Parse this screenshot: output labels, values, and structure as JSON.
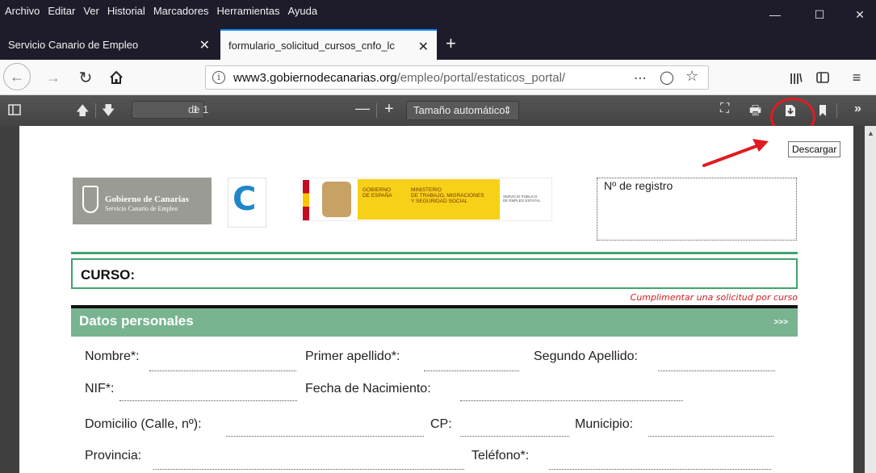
{
  "menu": [
    "Archivo",
    "Editar",
    "Ver",
    "Historial",
    "Marcadores",
    "Herramientas",
    "Ayuda"
  ],
  "tabs": [
    {
      "label": "Servicio Canario de Empleo",
      "active": false
    },
    {
      "label": "formulario_solicitud_cursos_cnfo_lc",
      "active": true
    }
  ],
  "address": {
    "host": "www3.gobiernodecanarias.org",
    "path": "/empleo/portal/estaticos_portal/"
  },
  "pdf": {
    "page": "1",
    "of": "de 1",
    "zoom": "Tamaño automático",
    "tooltip": "Descargar"
  },
  "form": {
    "logo_line1": "Gobierno de Canarias",
    "logo_line2": "Servicio Canario de Empleo",
    "gob_line1": "GOBIERNO\nDE ESPAÑA",
    "gob_line2": "MINISTERIO\nDE TRABAJO, MIGRACIONES\nY SEGURIDAD SOCIAL",
    "gob_line3": "SERVICIO PÚBLICO\nDE EMPLEO ESTATAL",
    "registro": "Nº de registro",
    "curso": "CURSO:",
    "note": "Cumplimentar una solicitud por curso",
    "section": "Datos personales",
    "section_arrows": ">>>",
    "fields": {
      "nombre": "Nombre*:",
      "apellido1": "Primer apellido*:",
      "apellido2": "Segundo Apellido:",
      "nif": "NIF*:",
      "nacimiento": "Fecha de Nacimiento:",
      "domicilio": "Domicilio (Calle, nº):",
      "cp": "CP:",
      "municipio": "Municipio:",
      "provincia": "Provincia:",
      "telefono": "Teléfono*:"
    }
  },
  "colors": {
    "accent": "#0a84ff",
    "green": "#3fa46a",
    "section": "#79b491",
    "highlight": "#e01b24"
  }
}
